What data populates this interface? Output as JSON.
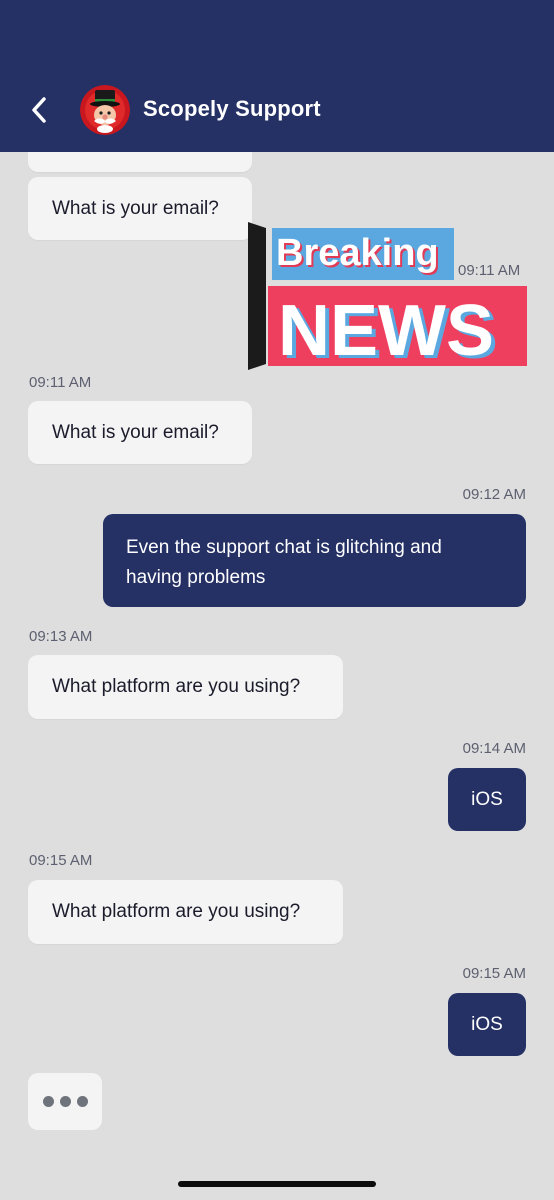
{
  "header": {
    "title": "Scopely Support",
    "background": "#253065"
  },
  "sticker": {
    "line1": "Breaking",
    "line2": "NEWS",
    "timestamp": "09:11 AM"
  },
  "messages": [
    {
      "from": "support",
      "text": "What is your email?"
    },
    {
      "from": "support",
      "timestamp": "09:11 AM",
      "text": "What is your email?"
    },
    {
      "from": "user",
      "timestamp": "09:12 AM",
      "text": "Even the support chat is glitching and having problems"
    },
    {
      "from": "support",
      "timestamp": "09:13 AM",
      "text": "What platform are you using?"
    },
    {
      "from": "user",
      "timestamp": "09:14 AM",
      "text": "iOS"
    },
    {
      "from": "support",
      "timestamp": "09:15 AM",
      "text": "What platform are you using?"
    },
    {
      "from": "user",
      "timestamp": "09:15 AM",
      "text": "iOS"
    }
  ],
  "colors": {
    "incoming_bubble": "#f4f4f4",
    "outgoing_bubble": "#253065",
    "chat_background": "#dedede",
    "sticker_blue": "#5ba8e0",
    "sticker_red": "#ef3f5f"
  },
  "icons": {
    "back": "chevron-left-icon",
    "typing": "typing-indicator-icon"
  }
}
